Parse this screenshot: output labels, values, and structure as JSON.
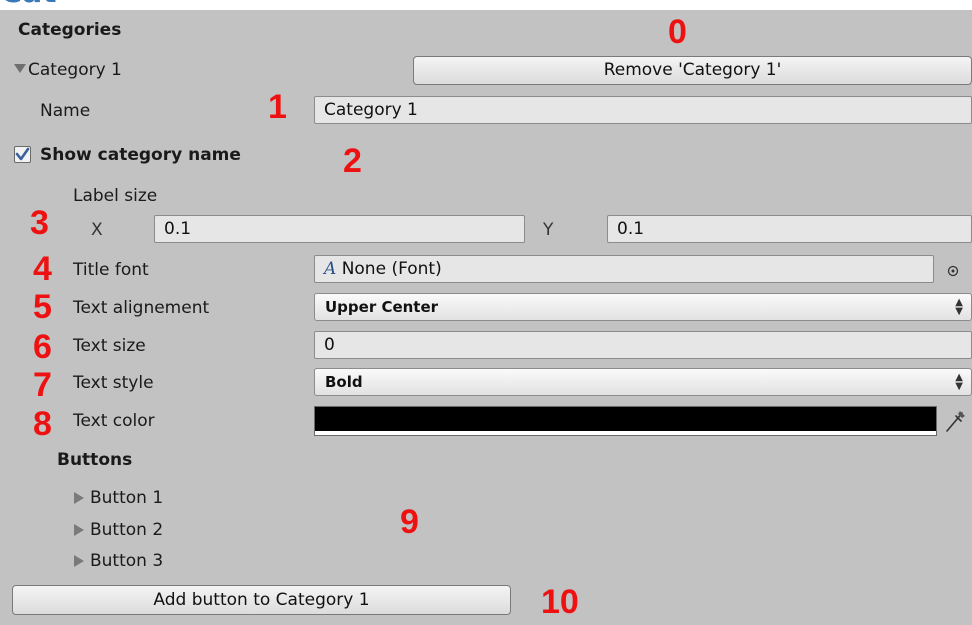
{
  "page_heading": "Categories",
  "panel": {
    "title": "Categories",
    "foldout_label": "Category 1",
    "remove_button_label": "Remove 'Category 1'",
    "name_label": "Name",
    "name_value": "Category 1",
    "show_name_label": "Show category name",
    "show_name_checked": true,
    "label_size_label": "Label size",
    "x_label": "X",
    "x_value": "0.1",
    "y_label": "Y",
    "y_value": "0.1",
    "title_font_label": "Title font",
    "title_font_value": "None (Font)",
    "title_font_icon": "A",
    "text_alignment_label": "Text alignement",
    "text_alignment_value": "Upper Center",
    "text_size_label": "Text size",
    "text_size_value": "0",
    "text_style_label": "Text style",
    "text_style_value": "Bold",
    "text_color_label": "Text color",
    "text_color_value": "#000000",
    "buttons_label": "Buttons",
    "buttons": [
      "Button 1",
      "Button 2",
      "Button 3"
    ],
    "add_button_label": "Add button to Category 1"
  },
  "annotations": [
    "0",
    "1",
    "2",
    "3",
    "4",
    "5",
    "6",
    "7",
    "8",
    "9",
    "10"
  ],
  "colors": {
    "panel_bg": "#c2c2c2",
    "annotation": "#ee1111",
    "heading": "#3a78b8"
  }
}
